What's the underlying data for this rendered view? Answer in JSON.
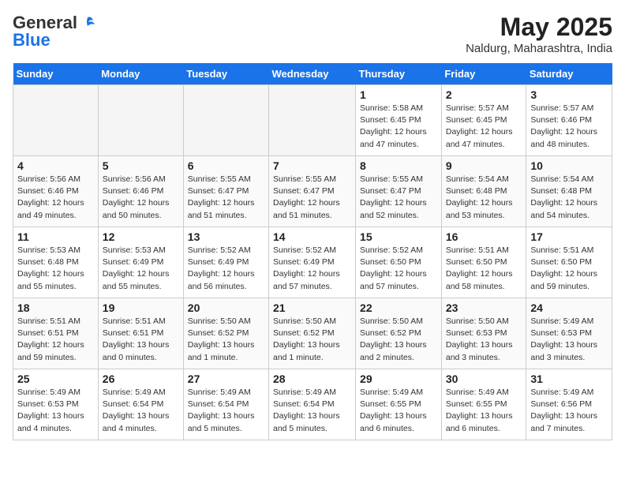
{
  "header": {
    "logo_line1": "General",
    "logo_line2": "Blue",
    "month": "May 2025",
    "location": "Naldurg, Maharashtra, India"
  },
  "weekdays": [
    "Sunday",
    "Monday",
    "Tuesday",
    "Wednesday",
    "Thursday",
    "Friday",
    "Saturday"
  ],
  "weeks": [
    [
      {
        "day": "",
        "detail": ""
      },
      {
        "day": "",
        "detail": ""
      },
      {
        "day": "",
        "detail": ""
      },
      {
        "day": "",
        "detail": ""
      },
      {
        "day": "1",
        "detail": "Sunrise: 5:58 AM\nSunset: 6:45 PM\nDaylight: 12 hours\nand 47 minutes."
      },
      {
        "day": "2",
        "detail": "Sunrise: 5:57 AM\nSunset: 6:45 PM\nDaylight: 12 hours\nand 47 minutes."
      },
      {
        "day": "3",
        "detail": "Sunrise: 5:57 AM\nSunset: 6:46 PM\nDaylight: 12 hours\nand 48 minutes."
      }
    ],
    [
      {
        "day": "4",
        "detail": "Sunrise: 5:56 AM\nSunset: 6:46 PM\nDaylight: 12 hours\nand 49 minutes."
      },
      {
        "day": "5",
        "detail": "Sunrise: 5:56 AM\nSunset: 6:46 PM\nDaylight: 12 hours\nand 50 minutes."
      },
      {
        "day": "6",
        "detail": "Sunrise: 5:55 AM\nSunset: 6:47 PM\nDaylight: 12 hours\nand 51 minutes."
      },
      {
        "day": "7",
        "detail": "Sunrise: 5:55 AM\nSunset: 6:47 PM\nDaylight: 12 hours\nand 51 minutes."
      },
      {
        "day": "8",
        "detail": "Sunrise: 5:55 AM\nSunset: 6:47 PM\nDaylight: 12 hours\nand 52 minutes."
      },
      {
        "day": "9",
        "detail": "Sunrise: 5:54 AM\nSunset: 6:48 PM\nDaylight: 12 hours\nand 53 minutes."
      },
      {
        "day": "10",
        "detail": "Sunrise: 5:54 AM\nSunset: 6:48 PM\nDaylight: 12 hours\nand 54 minutes."
      }
    ],
    [
      {
        "day": "11",
        "detail": "Sunrise: 5:53 AM\nSunset: 6:48 PM\nDaylight: 12 hours\nand 55 minutes."
      },
      {
        "day": "12",
        "detail": "Sunrise: 5:53 AM\nSunset: 6:49 PM\nDaylight: 12 hours\nand 55 minutes."
      },
      {
        "day": "13",
        "detail": "Sunrise: 5:52 AM\nSunset: 6:49 PM\nDaylight: 12 hours\nand 56 minutes."
      },
      {
        "day": "14",
        "detail": "Sunrise: 5:52 AM\nSunset: 6:49 PM\nDaylight: 12 hours\nand 57 minutes."
      },
      {
        "day": "15",
        "detail": "Sunrise: 5:52 AM\nSunset: 6:50 PM\nDaylight: 12 hours\nand 57 minutes."
      },
      {
        "day": "16",
        "detail": "Sunrise: 5:51 AM\nSunset: 6:50 PM\nDaylight: 12 hours\nand 58 minutes."
      },
      {
        "day": "17",
        "detail": "Sunrise: 5:51 AM\nSunset: 6:50 PM\nDaylight: 12 hours\nand 59 minutes."
      }
    ],
    [
      {
        "day": "18",
        "detail": "Sunrise: 5:51 AM\nSunset: 6:51 PM\nDaylight: 12 hours\nand 59 minutes."
      },
      {
        "day": "19",
        "detail": "Sunrise: 5:51 AM\nSunset: 6:51 PM\nDaylight: 13 hours\nand 0 minutes."
      },
      {
        "day": "20",
        "detail": "Sunrise: 5:50 AM\nSunset: 6:52 PM\nDaylight: 13 hours\nand 1 minute."
      },
      {
        "day": "21",
        "detail": "Sunrise: 5:50 AM\nSunset: 6:52 PM\nDaylight: 13 hours\nand 1 minute."
      },
      {
        "day": "22",
        "detail": "Sunrise: 5:50 AM\nSunset: 6:52 PM\nDaylight: 13 hours\nand 2 minutes."
      },
      {
        "day": "23",
        "detail": "Sunrise: 5:50 AM\nSunset: 6:53 PM\nDaylight: 13 hours\nand 3 minutes."
      },
      {
        "day": "24",
        "detail": "Sunrise: 5:49 AM\nSunset: 6:53 PM\nDaylight: 13 hours\nand 3 minutes."
      }
    ],
    [
      {
        "day": "25",
        "detail": "Sunrise: 5:49 AM\nSunset: 6:53 PM\nDaylight: 13 hours\nand 4 minutes."
      },
      {
        "day": "26",
        "detail": "Sunrise: 5:49 AM\nSunset: 6:54 PM\nDaylight: 13 hours\nand 4 minutes."
      },
      {
        "day": "27",
        "detail": "Sunrise: 5:49 AM\nSunset: 6:54 PM\nDaylight: 13 hours\nand 5 minutes."
      },
      {
        "day": "28",
        "detail": "Sunrise: 5:49 AM\nSunset: 6:54 PM\nDaylight: 13 hours\nand 5 minutes."
      },
      {
        "day": "29",
        "detail": "Sunrise: 5:49 AM\nSunset: 6:55 PM\nDaylight: 13 hours\nand 6 minutes."
      },
      {
        "day": "30",
        "detail": "Sunrise: 5:49 AM\nSunset: 6:55 PM\nDaylight: 13 hours\nand 6 minutes."
      },
      {
        "day": "31",
        "detail": "Sunrise: 5:49 AM\nSunset: 6:56 PM\nDaylight: 13 hours\nand 7 minutes."
      }
    ]
  ]
}
